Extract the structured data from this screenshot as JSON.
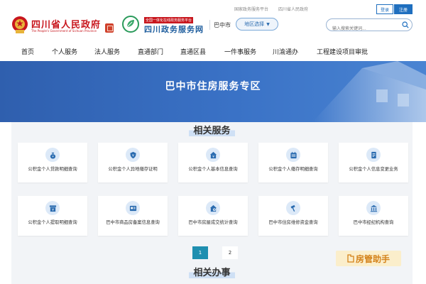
{
  "header": {
    "gov_title": "四川省人民政府",
    "gov_subtitle": "The People's Government of Sichuan Province",
    "portal_badge": "全国一体化在线政务服务平台",
    "portal_name": "四川政务服务网",
    "city": "巴中市",
    "region_button": "地区选择",
    "top_links": [
      "国家政务服务平台",
      "四川省人民政府"
    ],
    "login": "登录",
    "register": "注册",
    "search_placeholder": "输入搜索关键词..."
  },
  "nav": [
    "首页",
    "个人服务",
    "法人服务",
    "直通部门",
    "直通区县",
    "一件事服务",
    "川渝通办",
    "工程建设项目审批"
  ],
  "banner": {
    "title": "巴中市住房服务专区"
  },
  "services": {
    "title": "相关服务",
    "cards": [
      {
        "label": "公积金个人贷款明细查询",
        "icon": "money-bag-icon"
      },
      {
        "label": "公积金个人异地缴存证明",
        "icon": "shield-yen-icon"
      },
      {
        "label": "公积金个人基本信息查询",
        "icon": "house-yen-icon"
      },
      {
        "label": "公积金个人缴存明细查询",
        "icon": "calendar-icon"
      },
      {
        "label": "公积金个人信息变更业务",
        "icon": "document-icon"
      },
      {
        "label": "公积金个人提取明细查询",
        "icon": "archive-icon"
      },
      {
        "label": "巴中市商品房备案信息查询",
        "icon": "id-card-icon"
      },
      {
        "label": "巴中市房屋成交统计查询",
        "icon": "house-stats-icon"
      },
      {
        "label": "巴中市住房维修资金查询",
        "icon": "hammer-icon"
      },
      {
        "label": "巴中市经纪机构查询",
        "icon": "institution-icon"
      }
    ],
    "pages": [
      "1",
      "2"
    ]
  },
  "affairs": {
    "title": "相关办事"
  },
  "watermark": {
    "text": "房管助手"
  },
  "colors": {
    "primary": "#1f6fbf",
    "gov_red": "#c8161d",
    "page_active": "#1f8fb0"
  }
}
